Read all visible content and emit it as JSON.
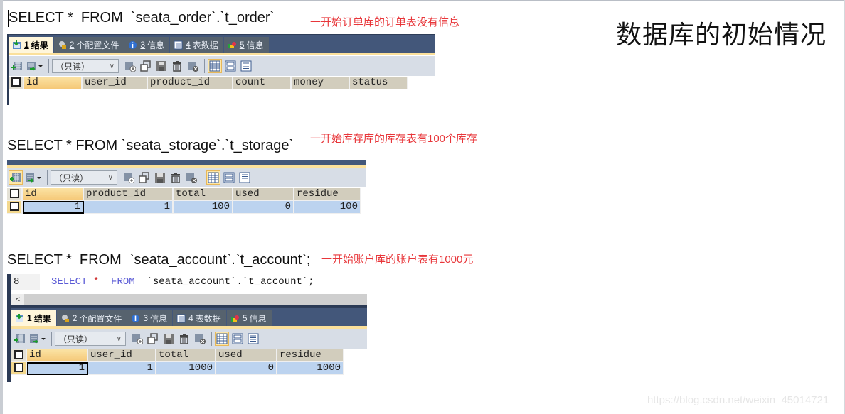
{
  "page_title": "数据库的初始情况",
  "watermark": "https://blog.csdn.net/weixin_45014721",
  "sections": [
    {
      "query": "SELECT *  FROM  `seata_order`.`t_order`",
      "note": "一开始订单库的订单表没有信息",
      "columns": [
        "id",
        "user_id",
        "product_id",
        "count",
        "money",
        "status"
      ],
      "rows": []
    },
    {
      "query": "SELECT * FROM `seata_storage`.`t_storage`",
      "note": "一开始库存库的库存表有100个库存",
      "columns": [
        "id",
        "product_id",
        "total",
        "used",
        "residue"
      ],
      "rows": [
        [
          "1",
          "1",
          "100",
          "0",
          "100"
        ]
      ]
    },
    {
      "query": "SELECT *  FROM  `seata_account`.`t_account`;",
      "note": "一开始账户库的账户表有1000元",
      "editor": {
        "line_number": "8",
        "keyword_select": "SELECT",
        "star": "*",
        "keyword_from": "FROM",
        "identifier": "`seata_account`.`t_account`;"
      },
      "columns": [
        "id",
        "user_id",
        "total",
        "used",
        "residue"
      ],
      "rows": [
        [
          "1",
          "1",
          "1000",
          "0",
          "1000"
        ]
      ]
    }
  ],
  "result_tabs": [
    {
      "num": "1",
      "label": "结果",
      "icon": "result-grid-icon"
    },
    {
      "num": "2",
      "label": "个配置文件",
      "icon": "profile-icon"
    },
    {
      "num": "3",
      "label": "信息",
      "icon": "info-icon"
    },
    {
      "num": "4",
      "label": "表数据",
      "icon": "table-data-icon"
    },
    {
      "num": "5",
      "label": "信息",
      "icon": "info-colored-icon"
    }
  ],
  "toolbar": {
    "readonly_select": "（只读）",
    "dropdown_arrow": "∨",
    "scroll_left": "<"
  }
}
